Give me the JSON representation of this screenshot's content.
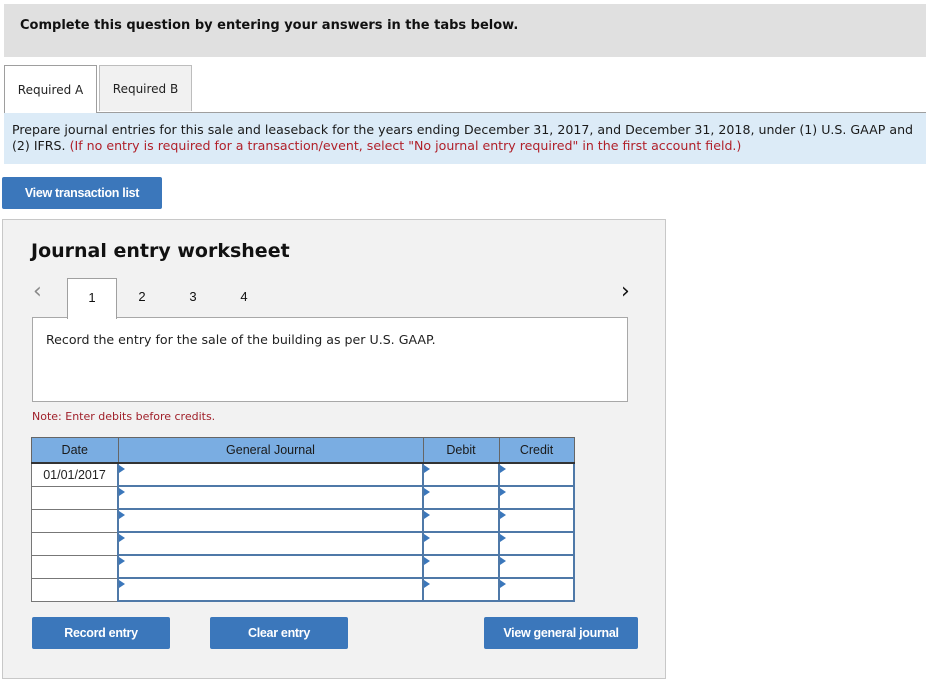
{
  "instructions": "Complete this question by entering your answers in the tabs below.",
  "tabs": [
    {
      "label": "Required A",
      "active": true
    },
    {
      "label": "Required B",
      "active": false
    }
  ],
  "prompt": {
    "text": "Prepare journal entries for this sale and leaseback for the years ending December 31, 2017, and December 31, 2018, under (1) U.S. GAAP and (2) IFRS.",
    "hint": "(If no entry is required for a transaction/event, select \"No journal entry required\" in the first account field.)"
  },
  "buttons": {
    "view_transaction_list": "View transaction list",
    "record_entry": "Record entry",
    "clear_entry": "Clear entry",
    "view_general_journal": "View general journal"
  },
  "worksheet": {
    "title": "Journal entry worksheet",
    "nav_prev_icon": "chevron-left-icon",
    "nav_next_icon": "chevron-right-icon",
    "steps": [
      "1",
      "2",
      "3",
      "4"
    ],
    "active_step": "1",
    "description": "Record the entry for the sale of the building as per U.S. GAAP.",
    "note": "Note: Enter debits before credits.",
    "table": {
      "headers": [
        "Date",
        "General Journal",
        "Debit",
        "Credit"
      ],
      "rows": [
        {
          "date": "01/01/2017",
          "account": "",
          "debit": "",
          "credit": ""
        },
        {
          "date": "",
          "account": "",
          "debit": "",
          "credit": ""
        },
        {
          "date": "",
          "account": "",
          "debit": "",
          "credit": ""
        },
        {
          "date": "",
          "account": "",
          "debit": "",
          "credit": ""
        },
        {
          "date": "",
          "account": "",
          "debit": "",
          "credit": ""
        },
        {
          "date": "",
          "account": "",
          "debit": "",
          "credit": ""
        }
      ]
    }
  },
  "colors": {
    "button_blue": "#3b77bb",
    "table_header": "#7aade2",
    "prompt_bg": "#dcebf7",
    "hint_red": "#b0202a"
  }
}
